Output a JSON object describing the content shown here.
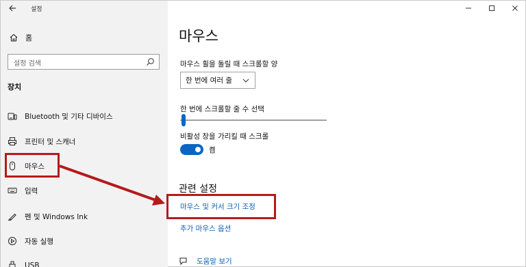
{
  "window": {
    "app_title": "설정"
  },
  "sidebar": {
    "home_label": "홈",
    "search_placeholder": "설정 검색",
    "section_heading": "장치",
    "items": [
      {
        "label": "Bluetooth 및 기타 디바이스",
        "icon": "bluetooth-devices-icon"
      },
      {
        "label": "프린터 및 스캐너",
        "icon": "printer-icon"
      },
      {
        "label": "마우스",
        "icon": "mouse-icon"
      },
      {
        "label": "입력",
        "icon": "keyboard-icon"
      },
      {
        "label": "펜 및 Windows Ink",
        "icon": "pen-icon"
      },
      {
        "label": "자동 실행",
        "icon": "autoplay-icon"
      },
      {
        "label": "USB",
        "icon": "usb-icon"
      }
    ]
  },
  "main": {
    "page_title": "마우스",
    "scroll_amount_label": "마우스 휠을 돌릴 때 스크롤할 양",
    "scroll_amount_value": "한 번에 여러 줄",
    "lines_label": "한 번에 스크롤할 줄 수 선택",
    "lines_slider_value": 0.03,
    "inactive_scroll_label": "비활성 창을 가리킬 때 스크롤",
    "inactive_scroll_state": "켬",
    "related_heading": "관련 설정",
    "links": {
      "mouse_cursor_size": "마우스 및 커서 크기 조정",
      "additional_mouse": "추가 마우스 옵션"
    },
    "help_link": "도움말 보기"
  },
  "colors": {
    "accent": "#0a66c2",
    "highlight": "#b31b1b",
    "sidebar_bg": "#f2f2f2"
  }
}
